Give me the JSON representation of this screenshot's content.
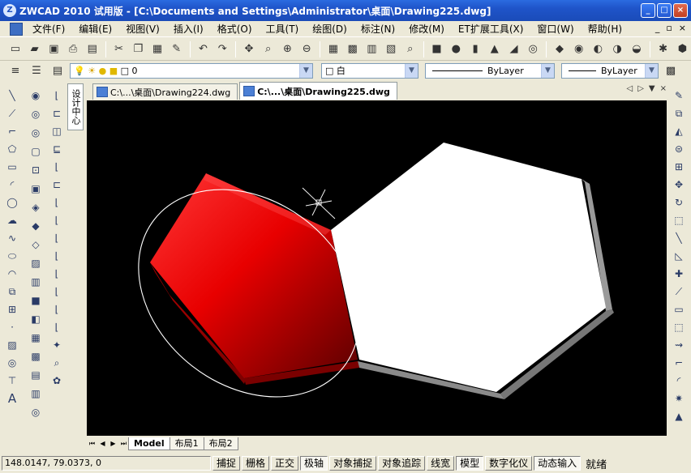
{
  "window": {
    "title": "ZWCAD 2010 试用版 - [C:\\Documents and Settings\\Administrator\\桌面\\Drawing225.dwg]"
  },
  "menu": [
    "文件(F)",
    "编辑(E)",
    "视图(V)",
    "插入(I)",
    "格式(O)",
    "工具(T)",
    "绘图(D)",
    "标注(N)",
    "修改(M)",
    "ET扩展工具(X)",
    "窗口(W)",
    "帮助(H)"
  ],
  "layer_combo": {
    "value": "0"
  },
  "color_combo": {
    "value": "白"
  },
  "linetype_combo": {
    "value": "ByLayer"
  },
  "lineweight_combo": {
    "value": "ByLayer"
  },
  "side_tab": {
    "label": "设计中心"
  },
  "doc_tabs": [
    {
      "label": "C:\\...\\桌面\\Drawing224.dwg",
      "active": false
    },
    {
      "label": "C:\\...\\桌面\\Drawing225.dwg",
      "active": true
    }
  ],
  "layout_tabs": [
    "Model",
    "布局1",
    "布局2"
  ],
  "status": {
    "coords": "148.0147,  79.0373,  0",
    "toggles": [
      {
        "label": "捕捉",
        "on": false
      },
      {
        "label": "栅格",
        "on": false
      },
      {
        "label": "正交",
        "on": false
      },
      {
        "label": "极轴",
        "on": true
      },
      {
        "label": "对象捕捉",
        "on": false
      },
      {
        "label": "对象追踪",
        "on": false
      },
      {
        "label": "线宽",
        "on": false
      },
      {
        "label": "模型",
        "on": true
      },
      {
        "label": "数字化仪",
        "on": false
      },
      {
        "label": "动态输入",
        "on": true
      }
    ],
    "ready": "就绪"
  },
  "colors": {
    "red_face": "#ff1a1a",
    "white_face": "#ffffff",
    "background": "#000000"
  }
}
